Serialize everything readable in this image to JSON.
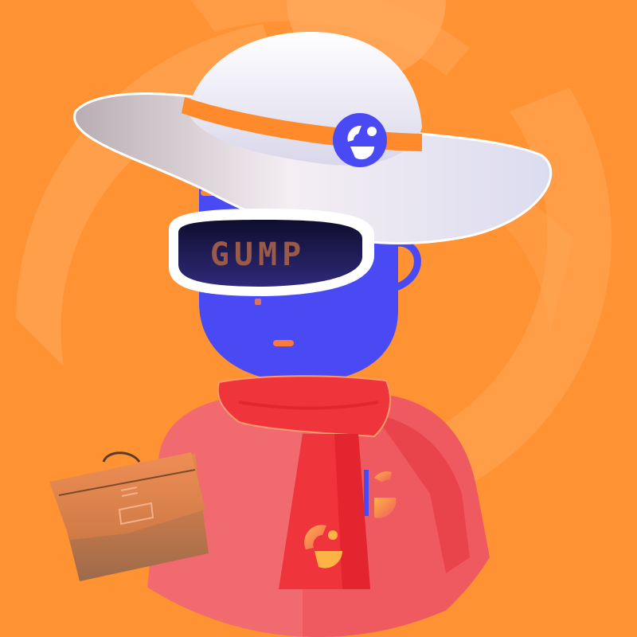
{
  "avatar": {
    "visor_text": "GUMP"
  },
  "colors": {
    "background": "#ff9233",
    "background_ring": "#ffa95c",
    "head": "#4a4af5",
    "hat": "#f7f3f7",
    "hat_band": "#ff8a2b",
    "visor": "#1e1a5a",
    "visor_text": "#9a5a4a",
    "shirt": "#ef5a60",
    "scarf": "#f0343c",
    "bag": "#c9733f"
  },
  "icons": {
    "hat_badge": "g-logo-icon",
    "scarf_badge": "g-logo-icon",
    "shirt_badge": "g-logo-icon",
    "bag": "briefcase-icon"
  }
}
